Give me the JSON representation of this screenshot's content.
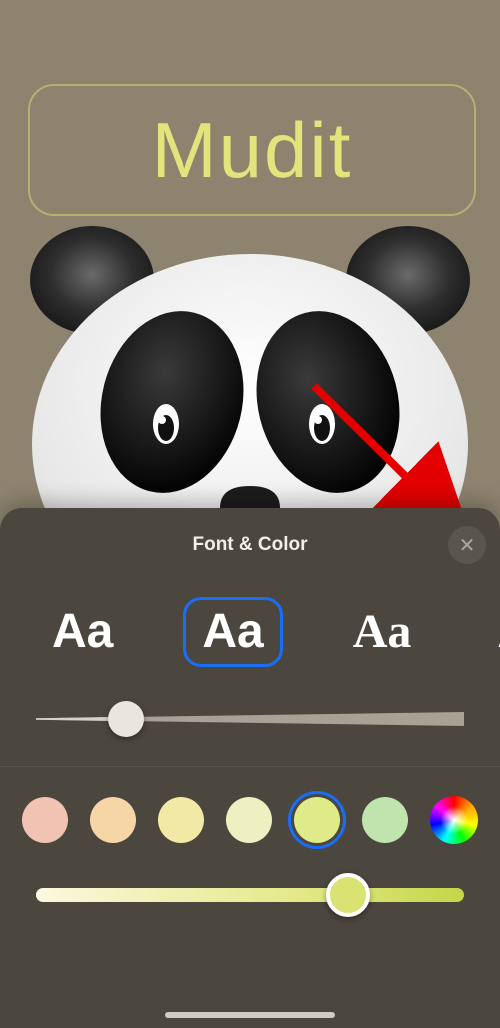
{
  "name_text": "Mudit",
  "panel": {
    "title": "Font & Color",
    "close_label": "✕",
    "fonts": [
      {
        "sample": "Aa",
        "style": "sans",
        "selected": false
      },
      {
        "sample": "Aa",
        "style": "round",
        "selected": true
      },
      {
        "sample": "Aa",
        "style": "serif",
        "selected": false
      },
      {
        "sample": "Aa",
        "style": "cond",
        "selected": false
      }
    ],
    "weight_slider": {
      "value": 0.21,
      "min": 0,
      "max": 1
    },
    "colors": [
      {
        "hex": "#f1c3b3",
        "name": "peach",
        "selected": false
      },
      {
        "hex": "#f6d6a7",
        "name": "apricot",
        "selected": false
      },
      {
        "hex": "#f3e9a7",
        "name": "butter",
        "selected": false
      },
      {
        "hex": "#eef0c2",
        "name": "pale-yellow",
        "selected": false
      },
      {
        "hex": "#dfea88",
        "name": "chartreuse",
        "selected": true
      },
      {
        "hex": "#bfe4ae",
        "name": "mint",
        "selected": false
      }
    ],
    "hue_slider": {
      "value": 0.73,
      "min": 0,
      "max": 1
    }
  },
  "annotation": {
    "target": "close-button"
  }
}
